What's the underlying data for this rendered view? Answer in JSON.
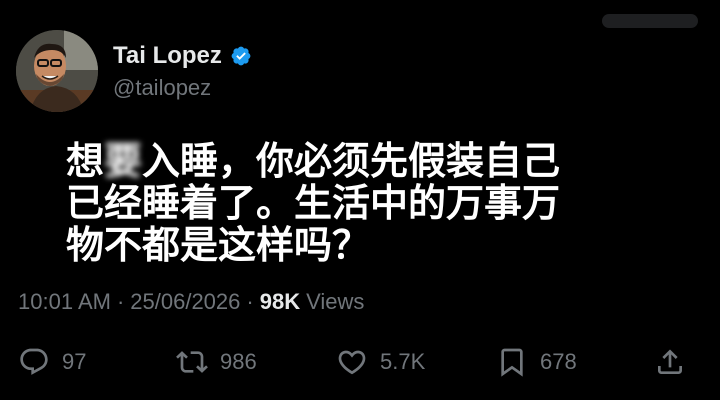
{
  "user": {
    "display_name": "Tai Lopez",
    "handle": "@tailopez",
    "verified": true,
    "badge_color": "#1d9bf0"
  },
  "tweet": {
    "lines": [
      [
        "想",
        "要",
        "入睡，你必须先假装自己"
      ],
      "已经睡着了。生活中的万事万",
      "物不都是这样吗？"
    ],
    "time": "10:01 AM",
    "date": "25/06/2026",
    "views_count": "98K",
    "views_label": "Views"
  },
  "meta_separator": "·",
  "actions": {
    "replies": {
      "icon": "reply-icon",
      "count": "97"
    },
    "retweets": {
      "icon": "retweet-icon",
      "count": "986"
    },
    "likes": {
      "icon": "like-icon",
      "count": "5.7K"
    },
    "bookmarks": {
      "icon": "bookmark-icon",
      "count": "678"
    },
    "share": {
      "icon": "share-icon"
    }
  },
  "colors": {
    "background": "#000000",
    "text_primary": "#e7e9ea",
    "text_secondary": "#71767b"
  }
}
